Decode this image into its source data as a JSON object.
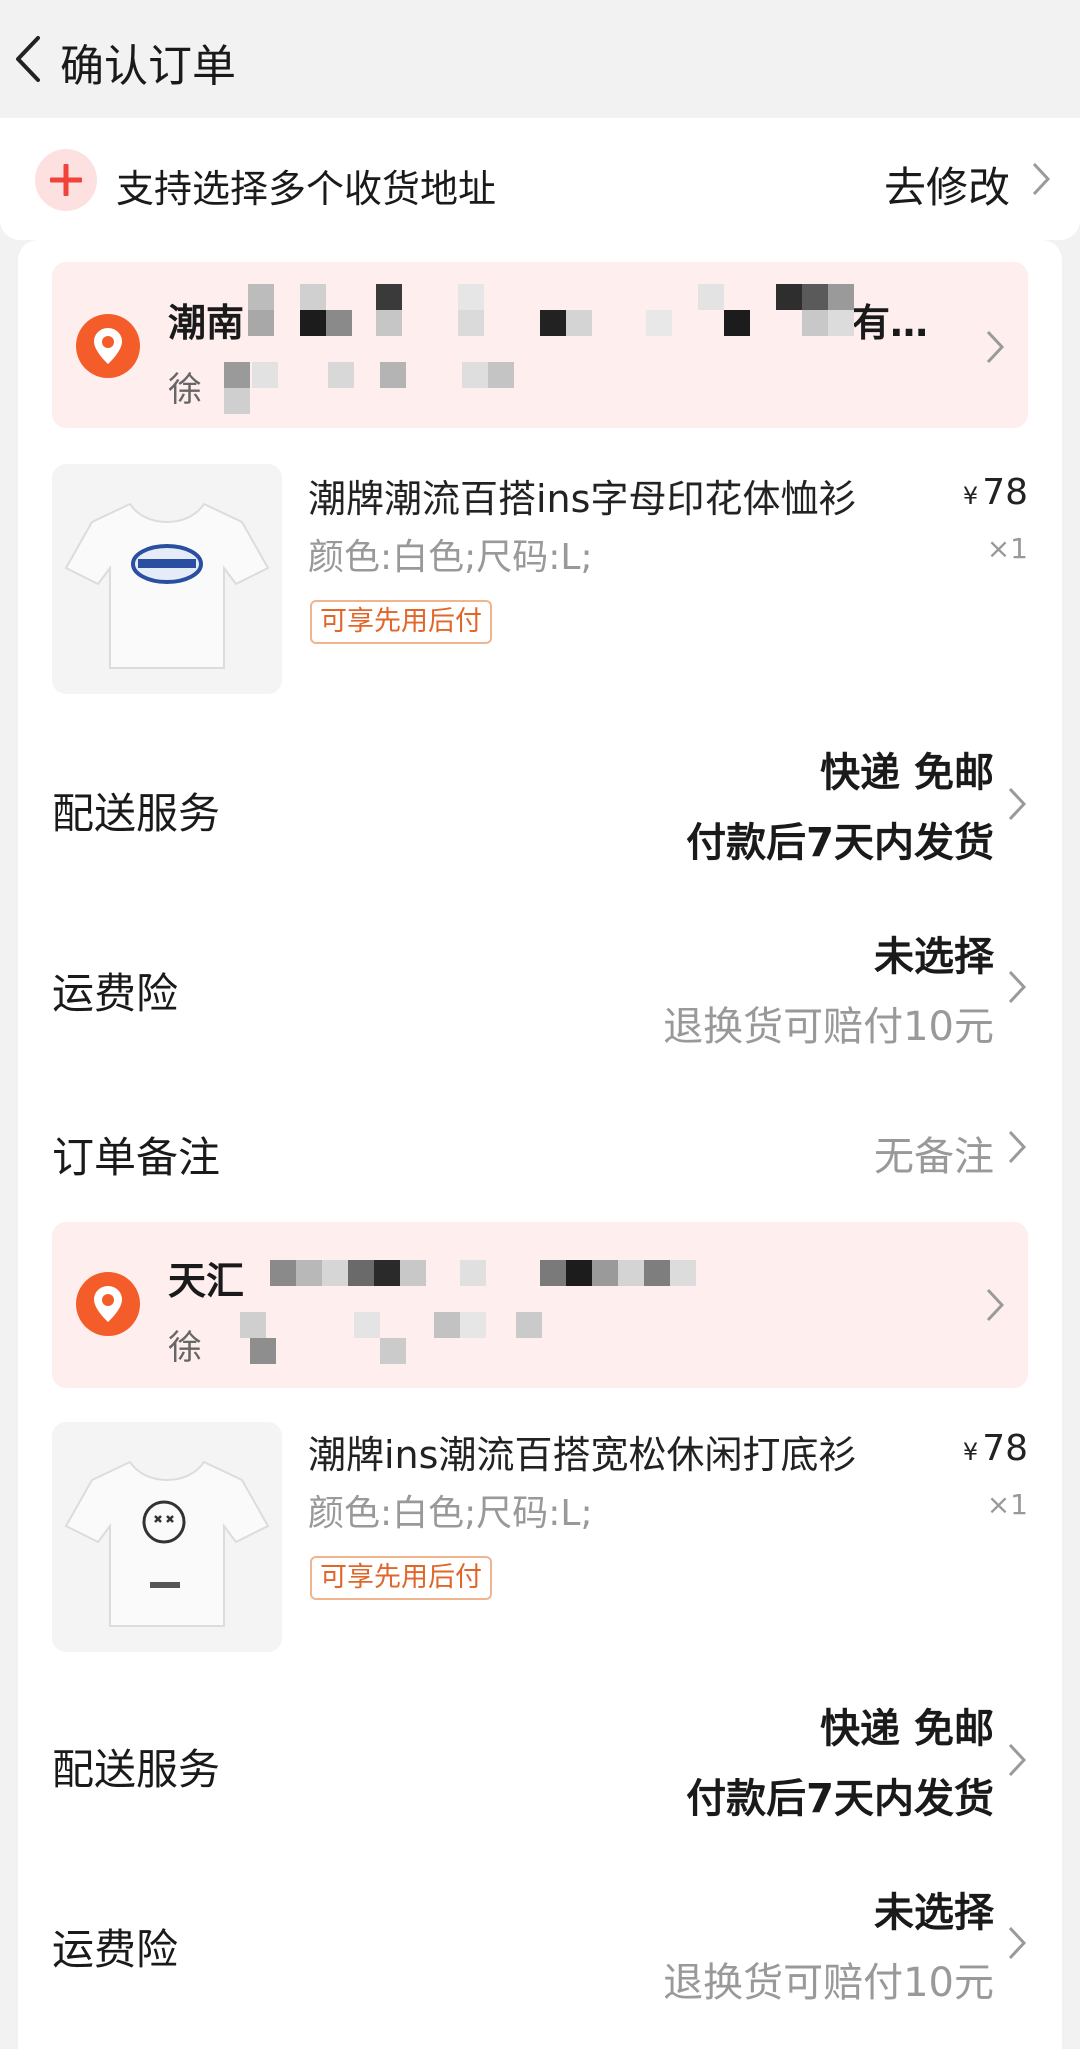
{
  "header": {
    "title": "确认订单"
  },
  "multi_address": {
    "label": "支持选择多个收货地址",
    "action": "去修改"
  },
  "orders": [
    {
      "address": {
        "line1": "潮南",
        "line1_tail": "有…",
        "line2": "徐"
      },
      "product": {
        "name": "潮牌潮流百搭ins字母印花体恤衫",
        "sku": "颜色:白色;尺码:L;",
        "tag": "可享先用后付",
        "currency": "¥",
        "price": "78",
        "qty": "×1"
      },
      "delivery": {
        "label": "配送服务",
        "main": "快递 免邮",
        "sub": "付款后7天内发货"
      },
      "insurance": {
        "label": "运费险",
        "main": "未选择",
        "sub": "退换货可赔付10元"
      },
      "remark": {
        "label": "订单备注",
        "value": "无备注"
      }
    },
    {
      "address": {
        "line1": "天汇",
        "line2": "徐"
      },
      "product": {
        "name": "潮牌ins潮流百搭宽松休闲打底衫",
        "sku": "颜色:白色;尺码:L;",
        "tag": "可享先用后付",
        "currency": "¥",
        "price": "78",
        "qty": "×1"
      },
      "delivery": {
        "label": "配送服务",
        "main": "快递 免邮",
        "sub": "付款后7天内发货"
      },
      "insurance": {
        "label": "运费险",
        "main": "未选择",
        "sub": "退换货可赔付10元"
      }
    }
  ],
  "colors": {
    "accent": "#f45d2a",
    "address_bg": "#ffeeee",
    "tag": "#e0662a",
    "page_bg": "#f2f2f2"
  }
}
